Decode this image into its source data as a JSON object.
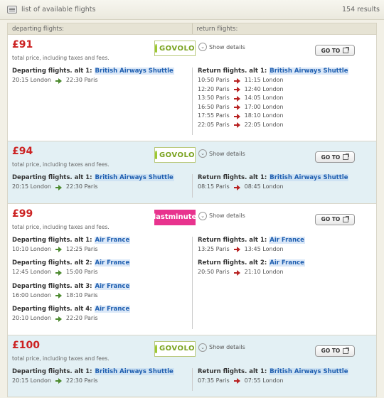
{
  "header": {
    "title": "list of available flights",
    "results": "154 results"
  },
  "columns": {
    "departing": "departing flights:",
    "returning": "return flights:"
  },
  "ui": {
    "show_details": "Show details",
    "go_to": "GO TO",
    "price_note": "total price, including taxes and fees."
  },
  "colors": {
    "price": "#cc2222",
    "airline_link": "#1f5fb0",
    "dep_arrow": "#4c8a2e",
    "ret_arrow": "#b82222",
    "card_alt": "#e3f0f4"
  },
  "offers": [
    {
      "price": "£91",
      "provider": "GOVOLO",
      "departing": [
        {
          "title": "Departing flights. alt 1:",
          "airline": "British Airways Shuttle",
          "legs": [
            {
              "dep": "20:15 London",
              "arr": "22:30 Paris"
            }
          ]
        }
      ],
      "returning": [
        {
          "title": "Return flights. alt 1:",
          "airline": "British Airways Shuttle",
          "legs": [
            {
              "dep": "10:50 Paris",
              "arr": "11:15 London"
            },
            {
              "dep": "12:20 Paris",
              "arr": "12:40 London"
            },
            {
              "dep": "13:50 Paris",
              "arr": "14:05 London"
            },
            {
              "dep": "16:50 Paris",
              "arr": "17:00 London"
            },
            {
              "dep": "17:55 Paris",
              "arr": "18:10 London"
            },
            {
              "dep": "22:05 Paris",
              "arr": "22:05 London"
            }
          ]
        }
      ]
    },
    {
      "price": "£94",
      "provider": "GOVOLO",
      "departing": [
        {
          "title": "Departing flights. alt 1:",
          "airline": "British Airways Shuttle",
          "legs": [
            {
              "dep": "20:15 London",
              "arr": "22:30 Paris"
            }
          ]
        }
      ],
      "returning": [
        {
          "title": "Return flights. alt 1:",
          "airline": "British Airways Shuttle",
          "legs": [
            {
              "dep": "08:15 Paris",
              "arr": "08:45 London"
            }
          ]
        }
      ]
    },
    {
      "price": "£99",
      "provider": "lastminute",
      "departing": [
        {
          "title": "Departing flights. alt 1:",
          "airline": "Air France",
          "legs": [
            {
              "dep": "10:10 London",
              "arr": "12:25 Paris"
            }
          ]
        },
        {
          "title": "Departing flights. alt 2:",
          "airline": "Air France",
          "legs": [
            {
              "dep": "12:45 London",
              "arr": "15:00 Paris"
            }
          ]
        },
        {
          "title": "Departing flights. alt 3:",
          "airline": "Air France",
          "legs": [
            {
              "dep": "16:00 London",
              "arr": "18:10 Paris"
            }
          ]
        },
        {
          "title": "Departing flights. alt 4:",
          "airline": "Air France",
          "legs": [
            {
              "dep": "20:10 London",
              "arr": "22:20 Paris"
            }
          ]
        }
      ],
      "returning": [
        {
          "title": "Return flights. alt 1:",
          "airline": "Air France",
          "legs": [
            {
              "dep": "13:25 Paris",
              "arr": "13:45 London"
            }
          ]
        },
        {
          "title": "Return flights. alt 2:",
          "airline": "Air France",
          "legs": [
            {
              "dep": "20:50 Paris",
              "arr": "21:10 London"
            }
          ]
        }
      ]
    },
    {
      "price": "£100",
      "provider": "GOVOLO",
      "departing": [
        {
          "title": "Departing flights. alt 1:",
          "airline": "British Airways Shuttle",
          "legs": [
            {
              "dep": "20:15 London",
              "arr": "22:30 Paris"
            }
          ]
        }
      ],
      "returning": [
        {
          "title": "Return flights. alt 1:",
          "airline": "British Airways Shuttle",
          "legs": [
            {
              "dep": "07:35 Paris",
              "arr": "07:55 London"
            }
          ]
        }
      ]
    }
  ]
}
